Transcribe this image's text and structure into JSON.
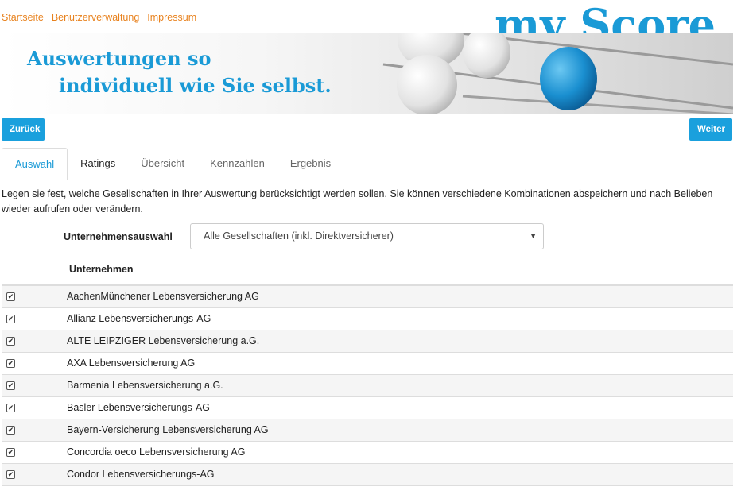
{
  "nav": {
    "items": [
      "Startseite",
      "Benutzerverwaltung",
      "Impressum"
    ]
  },
  "logo": {
    "text": "my Score"
  },
  "banner": {
    "line1": "Auswertungen so",
    "line2": "individuell wie Sie selbst."
  },
  "buttons": {
    "back": "Zurück",
    "next": "Weiter"
  },
  "tabs": [
    "Auswahl",
    "Ratings",
    "Übersicht",
    "Kennzahlen",
    "Ergebnis"
  ],
  "intro": "Legen sie fest, welche Gesellschaften in Ihrer Auswertung berücksichtigt werden sollen. Sie können verschiedene Kombinationen abspeichern und nach Belieben wieder aufrufen oder verändern.",
  "selection": {
    "label": "Unternehmensauswahl",
    "value": "Alle Gesellschaften (inkl. Direktversicherer)"
  },
  "table": {
    "header": "Unternehmen",
    "rows": [
      "AachenMünchener Lebensversicherung AG",
      "Allianz Lebensversicherungs-AG",
      "ALTE LEIPZIGER Lebensversicherung a.G.",
      "AXA Lebensversicherung AG",
      "Barmenia Lebensversicherung a.G.",
      "Basler Lebensversicherungs-AG",
      "Bayern-Versicherung Lebensversicherung AG",
      "Concordia oeco Lebensversicherung AG",
      "Condor Lebensversicherungs-AG"
    ]
  },
  "colors": {
    "accent": "#1aa0dd",
    "nav": "#e8821e"
  }
}
